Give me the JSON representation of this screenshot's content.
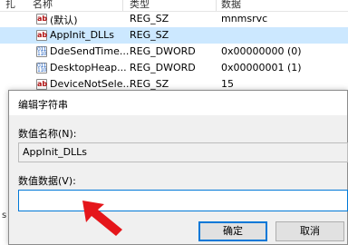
{
  "columns": {
    "name": "名称",
    "type": "类型",
    "data": "数据"
  },
  "left_edge": {
    "top_char": "扎",
    "bottom_char": "s"
  },
  "rows": [
    {
      "icon": "string-value-icon",
      "icon_glyph": "ab",
      "name": "(默认)",
      "type": "REG_SZ",
      "data": "mnmsrvc",
      "selected": false
    },
    {
      "icon": "string-value-icon",
      "icon_glyph": "ab",
      "name": "AppInit_DLLs",
      "type": "REG_SZ",
      "data": "",
      "selected": true
    },
    {
      "icon": "binary-value-icon",
      "icon_glyph": "011 110",
      "name": "DdeSendTime...",
      "type": "REG_DWORD",
      "data": "0x00000000 (0)",
      "selected": false
    },
    {
      "icon": "binary-value-icon",
      "icon_glyph": "011 110",
      "name": "DesktopHeap...",
      "type": "REG_DWORD",
      "data": "0x00000001 (1)",
      "selected": false
    },
    {
      "icon": "string-value-icon",
      "icon_glyph": "ab",
      "name": "DeviceNotSele...",
      "type": "REG_SZ",
      "data": "15",
      "selected": false
    }
  ],
  "dialog": {
    "title": "编辑字符串",
    "value_name_label": "数值名称(N):",
    "value_name": "AppInit_DLLs",
    "value_data_label": "数值数据(V):",
    "value_data": "",
    "ok_label": "确定",
    "cancel_label": "取消"
  },
  "colors": {
    "accent": "#0078d7",
    "selection": "#cce8ff",
    "arrow": "#e5161b"
  }
}
